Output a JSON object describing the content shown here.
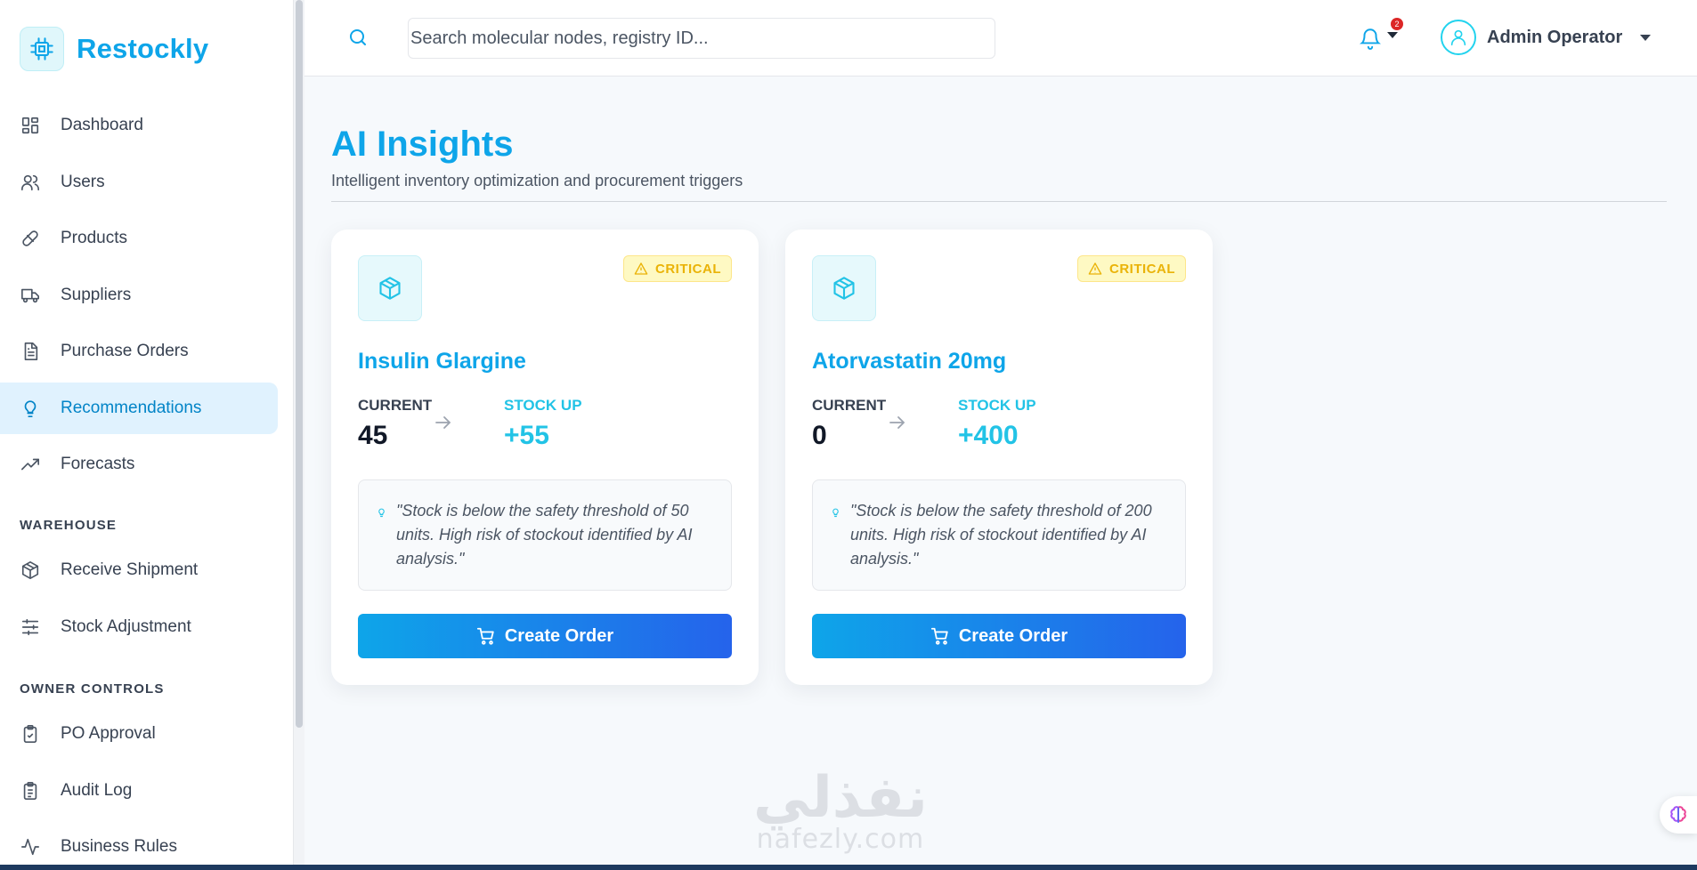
{
  "app": {
    "name": "Restockly"
  },
  "sidebar": {
    "items": [
      {
        "label": "Dashboard",
        "icon": "dashboard-icon"
      },
      {
        "label": "Users",
        "icon": "users-icon"
      },
      {
        "label": "Products",
        "icon": "pill-icon"
      },
      {
        "label": "Suppliers",
        "icon": "truck-icon"
      },
      {
        "label": "Purchase Orders",
        "icon": "document-icon"
      },
      {
        "label": "Recommendations",
        "icon": "lightbulb-icon",
        "active": true
      },
      {
        "label": "Forecasts",
        "icon": "trending-up-icon"
      }
    ],
    "warehouse_label": "WAREHOUSE",
    "warehouse_items": [
      {
        "label": "Receive Shipment",
        "icon": "package-check-icon"
      },
      {
        "label": "Stock Adjustment",
        "icon": "sliders-icon"
      }
    ],
    "owner_label": "OWNER CONTROLS",
    "owner_items": [
      {
        "label": "PO Approval",
        "icon": "clipboard-check-icon"
      },
      {
        "label": "Audit Log",
        "icon": "clipboard-list-icon"
      },
      {
        "label": "Business Rules",
        "icon": "activity-icon"
      }
    ]
  },
  "topbar": {
    "search_placeholder": "Search molecular nodes, registry ID...",
    "notification_count": "2",
    "user_name": "Admin Operator"
  },
  "page": {
    "title": "AI Insights",
    "subtitle": "Intelligent inventory optimization and procurement triggers"
  },
  "cards": [
    {
      "badge": "CRITICAL",
      "name": "Insulin Glargine",
      "current_label": "CURRENT",
      "current_value": "45",
      "stockup_label": "STOCK UP",
      "stockup_value": "+55",
      "note": "\"Stock is below the safety threshold of 50 units. High risk of stockout identified by AI analysis.\"",
      "button_label": "Create Order"
    },
    {
      "badge": "CRITICAL",
      "name": "Atorvastatin 20mg",
      "current_label": "CURRENT",
      "current_value": "0",
      "stockup_label": "STOCK UP",
      "stockup_value": "+400",
      "note": "\"Stock is below the safety threshold of 200 units. High risk of stockout identified by AI analysis.\"",
      "button_label": "Create Order"
    }
  ],
  "watermark": {
    "arabic": "نفذلي",
    "latin": "nafezly.com"
  },
  "colors": {
    "accent": "#0ea5e9",
    "cyan": "#22c3e6",
    "critical": "#eab308",
    "button_end": "#2563eb"
  }
}
